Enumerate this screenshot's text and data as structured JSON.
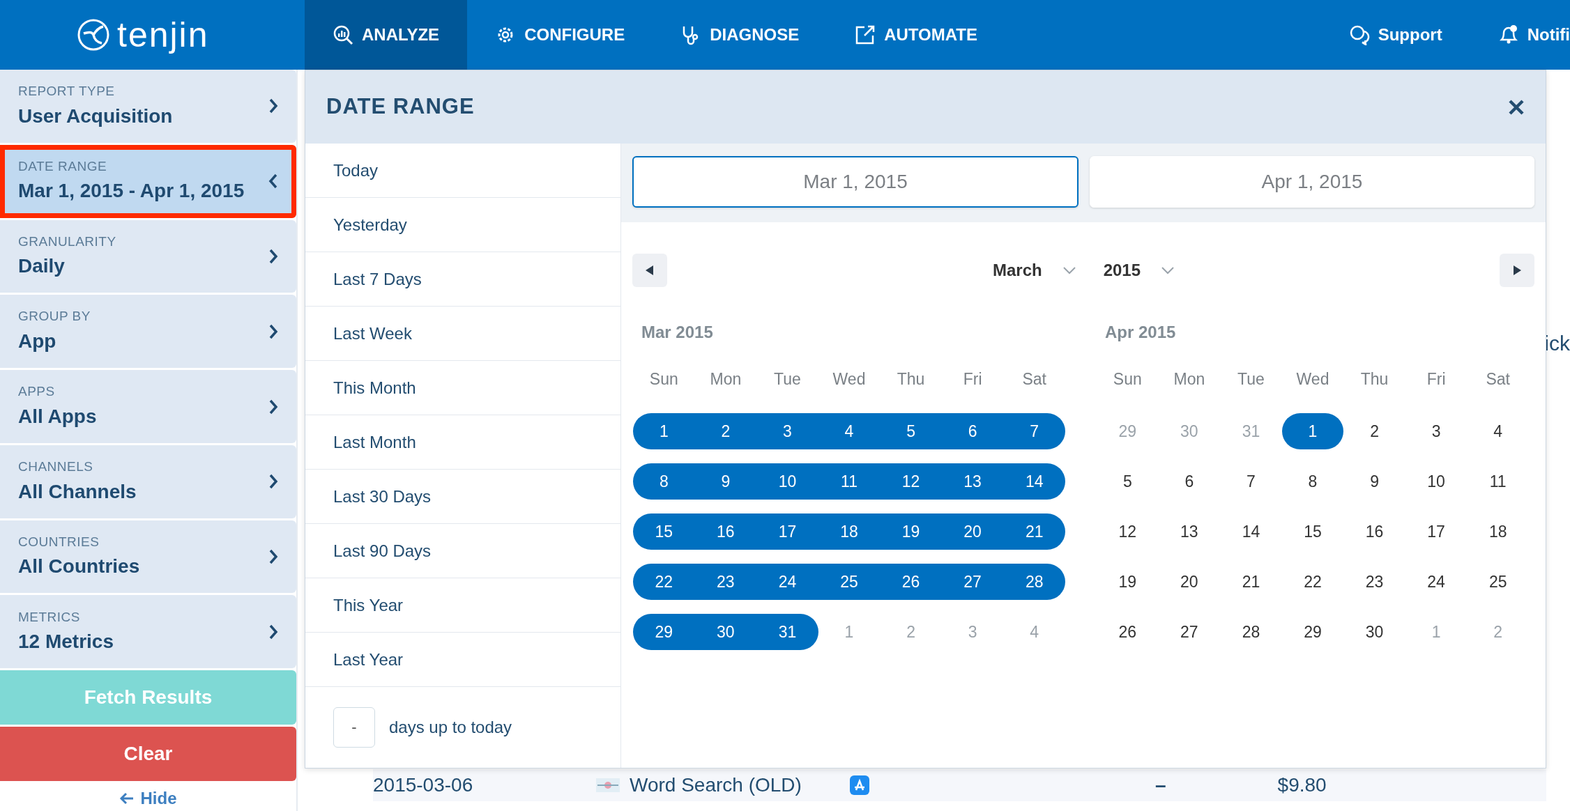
{
  "header": {
    "logo": "tenjin",
    "nav": [
      {
        "label": "ANALYZE",
        "selected": true
      },
      {
        "label": "CONFIGURE",
        "selected": false
      },
      {
        "label": "DIAGNOSE",
        "selected": false
      },
      {
        "label": "AUTOMATE",
        "selected": false
      }
    ],
    "right": [
      "Support",
      "Notifi"
    ]
  },
  "sidebar": {
    "filters": [
      {
        "label": "REPORT TYPE",
        "value": "User Acquisition",
        "selected": false
      },
      {
        "label": "DATE RANGE",
        "value": "Mar 1, 2015 - Apr 1, 2015",
        "selected": true
      },
      {
        "label": "GRANULARITY",
        "value": "Daily",
        "selected": false
      },
      {
        "label": "GROUP BY",
        "value": "App",
        "selected": false
      },
      {
        "label": "APPS",
        "value": "All Apps",
        "selected": false
      },
      {
        "label": "CHANNELS",
        "value": "All Channels",
        "selected": false
      },
      {
        "label": "COUNTRIES",
        "value": "All Countries",
        "selected": false
      },
      {
        "label": "METRICS",
        "value": "12 Metrics",
        "selected": false
      }
    ],
    "buttons": [
      {
        "label": "Fetch Results",
        "kind": "fetch"
      },
      {
        "label": "Clear",
        "kind": "clear"
      }
    ],
    "hide_link": "Hide"
  },
  "background": {
    "side_text": "ick",
    "row": [
      "2015-03-06",
      "Word Search (OLD)",
      "–",
      "$9.80"
    ]
  },
  "date_picker": {
    "title": "DATE RANGE",
    "presets": [
      "Today",
      "Yesterday",
      "Last 7 Days",
      "Last Week",
      "This Month",
      "Last Month",
      "Last 30 Days",
      "Last 90 Days",
      "This Year",
      "Last Year"
    ],
    "days_input": {
      "placeholder": "-",
      "label": "days up to today"
    },
    "start_date": {
      "value": "Mar 1, 2015",
      "selected": true
    },
    "end_date": {
      "value": "Apr 1, 2015",
      "selected": false
    },
    "month_select": "March",
    "year_select": "2015",
    "months": [
      {
        "title": "Mar 2015",
        "weekdays": [
          "Sun",
          "Mon",
          "Tue",
          "Wed",
          "Thu",
          "Fri",
          "Sat"
        ],
        "weeks": [
          [
            {
              "label": "1",
              "selected": true,
              "muted": false
            },
            {
              "label": "2",
              "selected": true,
              "muted": false
            },
            {
              "label": "3",
              "selected": true,
              "muted": false
            },
            {
              "label": "4",
              "selected": true,
              "muted": false
            },
            {
              "label": "5",
              "selected": true,
              "muted": false
            },
            {
              "label": "6",
              "selected": true,
              "muted": false
            },
            {
              "label": "7",
              "selected": true,
              "muted": false
            }
          ],
          [
            {
              "label": "8",
              "selected": true,
              "muted": false
            },
            {
              "label": "9",
              "selected": true,
              "muted": false
            },
            {
              "label": "10",
              "selected": true,
              "muted": false
            },
            {
              "label": "11",
              "selected": true,
              "muted": false
            },
            {
              "label": "12",
              "selected": true,
              "muted": false
            },
            {
              "label": "13",
              "selected": true,
              "muted": false
            },
            {
              "label": "14",
              "selected": true,
              "muted": false
            }
          ],
          [
            {
              "label": "15",
              "selected": true,
              "muted": false
            },
            {
              "label": "16",
              "selected": true,
              "muted": false
            },
            {
              "label": "17",
              "selected": true,
              "muted": false
            },
            {
              "label": "18",
              "selected": true,
              "muted": false
            },
            {
              "label": "19",
              "selected": true,
              "muted": false
            },
            {
              "label": "20",
              "selected": true,
              "muted": false
            },
            {
              "label": "21",
              "selected": true,
              "muted": false
            }
          ],
          [
            {
              "label": "22",
              "selected": true,
              "muted": false
            },
            {
              "label": "23",
              "selected": true,
              "muted": false
            },
            {
              "label": "24",
              "selected": true,
              "muted": false
            },
            {
              "label": "25",
              "selected": true,
              "muted": false
            },
            {
              "label": "26",
              "selected": true,
              "muted": false
            },
            {
              "label": "27",
              "selected": true,
              "muted": false
            },
            {
              "label": "28",
              "selected": true,
              "muted": false
            }
          ],
          [
            {
              "label": "29",
              "selected": true,
              "muted": false
            },
            {
              "label": "30",
              "selected": true,
              "muted": false
            },
            {
              "label": "31",
              "selected": true,
              "muted": false
            },
            {
              "label": "1",
              "selected": false,
              "muted": true
            },
            {
              "label": "2",
              "selected": false,
              "muted": true
            },
            {
              "label": "3",
              "selected": false,
              "muted": true
            },
            {
              "label": "4",
              "selected": false,
              "muted": true
            }
          ]
        ]
      },
      {
        "title": "Apr 2015",
        "weekdays": [
          "Sun",
          "Mon",
          "Tue",
          "Wed",
          "Thu",
          "Fri",
          "Sat"
        ],
        "weeks": [
          [
            {
              "label": "29",
              "selected": false,
              "muted": true
            },
            {
              "label": "30",
              "selected": false,
              "muted": true
            },
            {
              "label": "31",
              "selected": false,
              "muted": true
            },
            {
              "label": "1",
              "selected": true,
              "muted": false
            },
            {
              "label": "2",
              "selected": false,
              "muted": false
            },
            {
              "label": "3",
              "selected": false,
              "muted": false
            },
            {
              "label": "4",
              "selected": false,
              "muted": false
            }
          ],
          [
            {
              "label": "5",
              "selected": false,
              "muted": false
            },
            {
              "label": "6",
              "selected": false,
              "muted": false
            },
            {
              "label": "7",
              "selected": false,
              "muted": false
            },
            {
              "label": "8",
              "selected": false,
              "muted": false
            },
            {
              "label": "9",
              "selected": false,
              "muted": false
            },
            {
              "label": "10",
              "selected": false,
              "muted": false
            },
            {
              "label": "11",
              "selected": false,
              "muted": false
            }
          ],
          [
            {
              "label": "12",
              "selected": false,
              "muted": false
            },
            {
              "label": "13",
              "selected": false,
              "muted": false
            },
            {
              "label": "14",
              "selected": false,
              "muted": false
            },
            {
              "label": "15",
              "selected": false,
              "muted": false
            },
            {
              "label": "16",
              "selected": false,
              "muted": false
            },
            {
              "label": "17",
              "selected": false,
              "muted": false
            },
            {
              "label": "18",
              "selected": false,
              "muted": false
            }
          ],
          [
            {
              "label": "19",
              "selected": false,
              "muted": false
            },
            {
              "label": "20",
              "selected": false,
              "muted": false
            },
            {
              "label": "21",
              "selected": false,
              "muted": false
            },
            {
              "label": "22",
              "selected": false,
              "muted": false
            },
            {
              "label": "23",
              "selected": false,
              "muted": false
            },
            {
              "label": "24",
              "selected": false,
              "muted": false
            },
            {
              "label": "25",
              "selected": false,
              "muted": false
            }
          ],
          [
            {
              "label": "26",
              "selected": false,
              "muted": false
            },
            {
              "label": "27",
              "selected": false,
              "muted": false
            },
            {
              "label": "28",
              "selected": false,
              "muted": false
            },
            {
              "label": "29",
              "selected": false,
              "muted": false
            },
            {
              "label": "30",
              "selected": false,
              "muted": false
            },
            {
              "label": "1",
              "selected": false,
              "muted": true
            },
            {
              "label": "2",
              "selected": false,
              "muted": true
            }
          ]
        ]
      }
    ]
  }
}
